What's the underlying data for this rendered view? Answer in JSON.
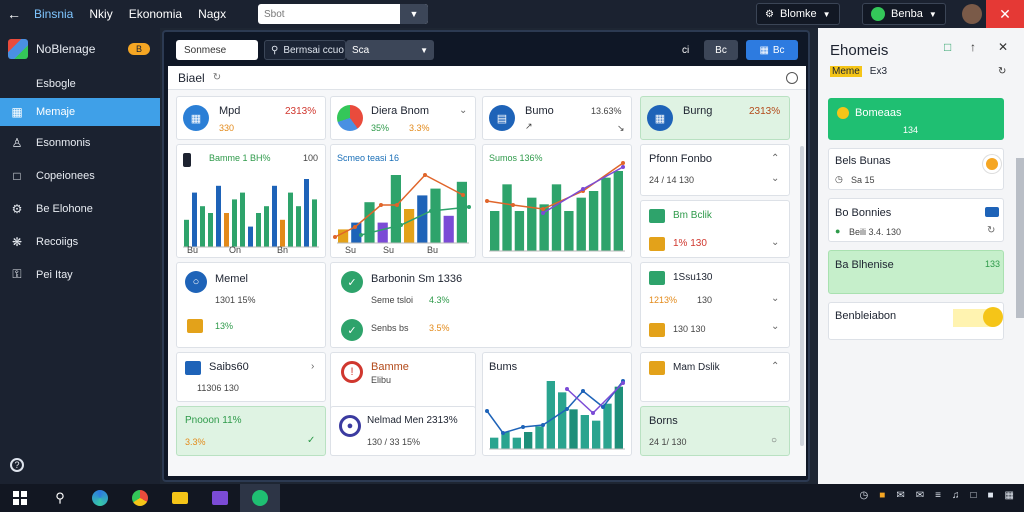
{
  "topbar": {
    "menu": [
      "Binsnia",
      "Nkiy",
      "Ekonomia",
      "Nagx"
    ],
    "search_placeholder": "Sbot",
    "account_label": "Blomke",
    "user_label": "Benba"
  },
  "sidebar": {
    "title": "NoBlenage",
    "badge": "B",
    "items": [
      {
        "label": "Esbogle",
        "icon": "home-icon"
      },
      {
        "label": "Memaje",
        "icon": "grid-icon",
        "active": true
      },
      {
        "label": "Esonmonis",
        "icon": "user-icon"
      },
      {
        "label": "Copeionees",
        "icon": "document-icon"
      },
      {
        "label": "Be Elohone",
        "icon": "gear-icon"
      },
      {
        "label": "Recoiigs",
        "icon": "settings-icon"
      },
      {
        "label": "Pei Itay",
        "icon": "key-icon"
      }
    ]
  },
  "window": {
    "tab1": "Sonmese",
    "tab2": "Bermsai ccuo",
    "tab3": "Sca",
    "tab4": "ci",
    "tab5": "Bc",
    "tab6": "Bc",
    "heading": "Biael"
  },
  "cards": {
    "c1": {
      "title": "Mpd",
      "value": "2313%",
      "sub": "330"
    },
    "c2": {
      "title": "Diera Bnom",
      "sub1": "35%",
      "sub2": "3.3%"
    },
    "c3": {
      "title": "Bumo",
      "value": "13.63%"
    },
    "c4": {
      "title": "Burng",
      "value": "2313%"
    },
    "chart1": {
      "legend": "Bamme 1 BH%",
      "right": "100",
      "labels": [
        "Bu",
        "On",
        "Bn"
      ]
    },
    "chart2": {
      "legend": "Scmeo teasi 16",
      "labels": [
        "Su",
        "Su",
        "Bu"
      ]
    },
    "chart3": {
      "legend": "Sumos 136%"
    },
    "r1": {
      "title": "Pfonn Fonbo",
      "sub": "24 / 14 130"
    },
    "r2": {
      "title": "Bm Bclik"
    },
    "r3": {
      "sub": "1% 130"
    },
    "m1": {
      "title": "Memel",
      "sub1": "1301 15%",
      "sub2": "13%"
    },
    "m2": {
      "title": "Barbonin Sm 1336",
      "sub1": "Seme tsloi",
      "val1": "4.3%",
      "sub2": "Senbs bs",
      "val2": "3.5%"
    },
    "r4": {
      "title": "1Ssu130",
      "val": "1213%",
      "sub": "130"
    },
    "r5": {
      "sub": "130 130"
    },
    "b1": {
      "title": "Saibs60",
      "sub": "11306 130"
    },
    "b2": {
      "title": "Bamme",
      "sub": "Elibu",
      "chart_title": "Bums"
    },
    "b3": {
      "title": "Mam Dslik"
    },
    "b4": {
      "title": "Pnooon 11% ",
      "sub": "3.3%"
    },
    "b5": {
      "title": "Nelmad Men 2313%",
      "sub": "130 / 33 15%"
    },
    "b6": {
      "title": "Borns",
      "sub": "24 1/ 130"
    }
  },
  "rpanel": {
    "title": "Ehomeis",
    "tab_active": "Meme",
    "tab_other": "Ex3",
    "items": [
      {
        "title": "Bomeaas",
        "sub": "134"
      },
      {
        "title": "Bels Bunas",
        "sub": "Sa 15"
      },
      {
        "title": "Bo Bonnies",
        "sub": "Beili 3.4. 130"
      },
      {
        "title": "Ba Blhenise",
        "sub": "133"
      },
      {
        "title": "Benbleiabon"
      }
    ]
  },
  "chart_data": [
    {
      "type": "bar",
      "title": "Bamme 1 BH%",
      "categories": [
        "Bu",
        "On",
        "Bn"
      ],
      "series": [
        {
          "values": [
            4,
            8,
            6,
            5,
            9,
            5,
            7,
            8,
            3,
            5,
            6,
            9,
            4,
            8,
            6,
            10,
            7
          ]
        }
      ]
    },
    {
      "type": "bar",
      "title": "Scmeo teasi 16",
      "categories": [
        "Su",
        "Su",
        "Bu"
      ],
      "series": [
        {
          "values": [
            2,
            3,
            6,
            3,
            10,
            5,
            7,
            8,
            4,
            9
          ]
        }
      ]
    },
    {
      "type": "bar",
      "title": "Sumos 136%",
      "series": [
        {
          "values": [
            6,
            10,
            6,
            8,
            7,
            10,
            6,
            8,
            9,
            11,
            12
          ]
        }
      ]
    },
    {
      "type": "bar",
      "title": "Bums",
      "series": [
        {
          "values": [
            2,
            3,
            2,
            3,
            4,
            12,
            10,
            7,
            6,
            5,
            8,
            11
          ]
        }
      ]
    }
  ]
}
